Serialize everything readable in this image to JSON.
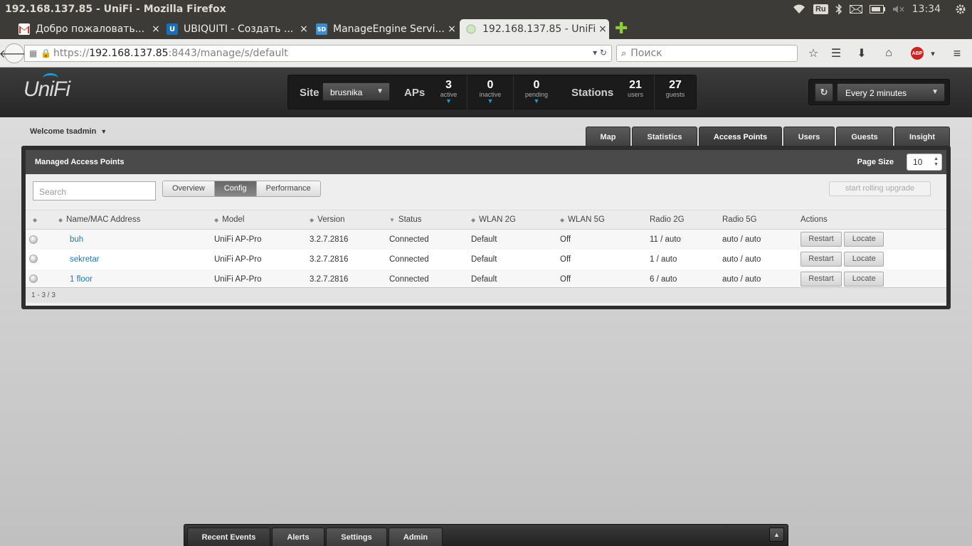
{
  "os": {
    "window_title": "192.168.137.85 - UniFi - Mozilla Firefox",
    "keyboard_layout": "Ru",
    "clock": "13:34"
  },
  "browser": {
    "tabs": [
      {
        "title": "Добро пожаловать...",
        "favicon": "gmail-icon"
      },
      {
        "title": "UBIQUITI - Создать ...",
        "favicon": "ubiquiti-icon"
      },
      {
        "title": "ManageEngine Servi...",
        "favicon": "servicedesk-icon"
      },
      {
        "title": "192.168.137.85 - UniFi",
        "favicon": "unifi-icon",
        "active": true
      }
    ],
    "url_scheme": "https://",
    "url_host": "192.168.137.85",
    "url_rest": ":8443/manage/s/default",
    "search_placeholder": "Поиск",
    "abp_label": "ABP"
  },
  "header": {
    "logo_text": "UniFi",
    "site_label": "Site",
    "site_value": "brusnika",
    "aps_label": "APs",
    "stations_label": "Stations",
    "stats": [
      {
        "value": "3",
        "label": "active"
      },
      {
        "value": "0",
        "label": "inactive"
      },
      {
        "value": "0",
        "label": "pending"
      },
      {
        "value": "21",
        "label": "users"
      },
      {
        "value": "27",
        "label": "guests"
      }
    ],
    "refresh_interval": "Every 2 minutes"
  },
  "main": {
    "welcome": "Welcome tsadmin",
    "nav_tabs": [
      "Map",
      "Statistics",
      "Access Points",
      "Users",
      "Guests",
      "Insight"
    ],
    "active_tab": "Access Points",
    "panel_title": "Managed Access Points",
    "page_size_label": "Page Size",
    "page_size_value": "10",
    "search_placeholder": "Search",
    "view_buttons": [
      "Overview",
      "Config",
      "Performance"
    ],
    "active_view": "Config",
    "rolling_upgrade_label": "start rolling upgrade",
    "columns": [
      "",
      "Name/MAC Address",
      "Model",
      "Version",
      "Status",
      "WLAN 2G",
      "WLAN 5G",
      "Radio 2G",
      "Radio 5G",
      "Actions"
    ],
    "rows": [
      {
        "name": "buh",
        "model": "UniFi AP-Pro",
        "version": "3.2.7.2816",
        "status": "Connected",
        "wlan2g": "Default",
        "wlan5g": "Off",
        "radio2g": "11 / auto",
        "radio5g": "auto / auto"
      },
      {
        "name": "sekretar",
        "model": "UniFi AP-Pro",
        "version": "3.2.7.2816",
        "status": "Connected",
        "wlan2g": "Default",
        "wlan5g": "Off",
        "radio2g": "1 / auto",
        "radio5g": "auto / auto"
      },
      {
        "name": "1 floor",
        "model": "UniFi AP-Pro",
        "version": "3.2.7.2816",
        "status": "Connected",
        "wlan2g": "Default",
        "wlan5g": "Off",
        "radio2g": "6 / auto",
        "radio5g": "auto / auto"
      }
    ],
    "restart_label": "Restart",
    "locate_label": "Locate",
    "pagination": "1 - 3 / 3"
  },
  "bottom_bar": {
    "tabs": [
      "Recent Events",
      "Alerts",
      "Settings",
      "Admin"
    ],
    "active_tab": "Recent Events"
  },
  "colors": {
    "accent": "#1a9ad6",
    "status_connected": "#228b22",
    "link": "#1a7ab8"
  }
}
